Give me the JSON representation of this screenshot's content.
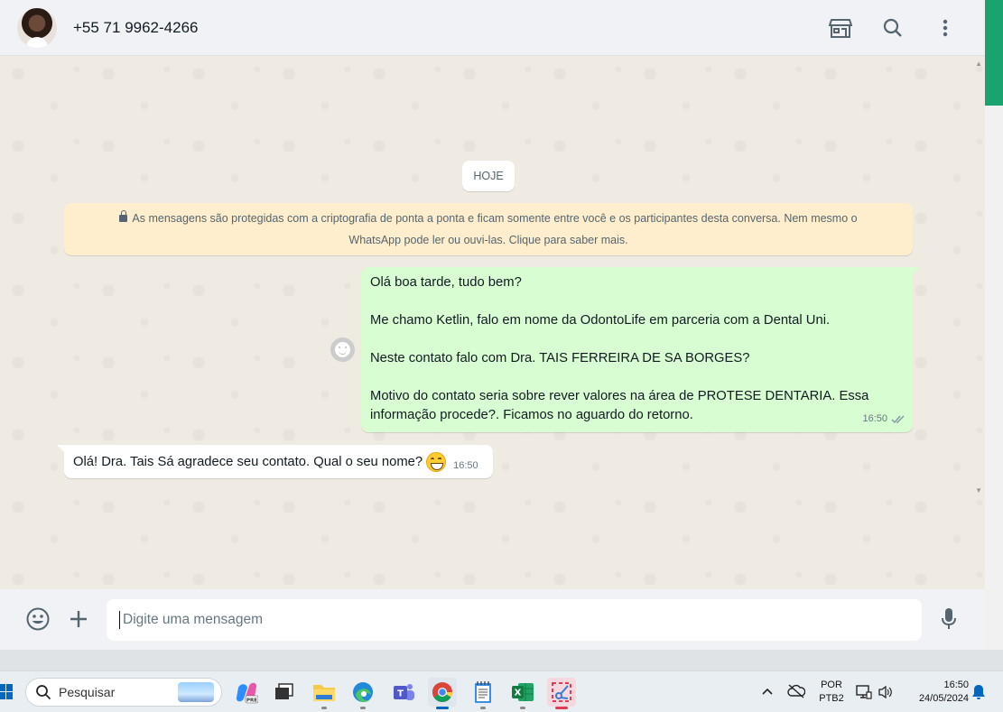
{
  "header": {
    "contact_name": "+55 71 9962-4266",
    "icons": [
      "shop-icon",
      "search-icon",
      "kebab-menu-icon"
    ]
  },
  "chat": {
    "date_label": "HOJE",
    "encryption_notice_line1": "As mensagens são protegidas com a criptografia de ponta a ponta e ficam somente entre você e os participantes desta conversa. Nem mesmo o",
    "encryption_notice_line2": "WhatsApp pode ler ou ouvi-las. Clique para saber mais.",
    "outgoing": {
      "lines": [
        "Olá boa tarde, tudo bem?",
        "Me chamo Ketlin, falo em nome da OdontoLife em parceria com a Dental Uni.",
        "Neste contato falo com Dra. TAIS FERREIRA DE SA BORGES?",
        "Motivo do contato seria sobre rever valores na área de PROTESE DENTARIA. Essa",
        "informação procede?. Ficamos no aguardo do retorno."
      ],
      "time": "16:50",
      "status": "read"
    },
    "incoming": {
      "text": "Olá! Dra. Tais Sá agradece seu contato. Qual o seu nome?",
      "emoji": "grinning-face",
      "time": "16:50"
    }
  },
  "composer": {
    "placeholder": "Digite uma mensagem"
  },
  "taskbar": {
    "search_label": "Pesquisar",
    "language_line1": "POR",
    "language_line2": "PTB2",
    "time": "16:50",
    "date": "24/05/2024"
  },
  "colors": {
    "accent": "#1aa26f",
    "outgoing_bubble": "#d9fdd3",
    "notice_bg": "#ffeecd",
    "chat_bg": "#efeae2"
  }
}
